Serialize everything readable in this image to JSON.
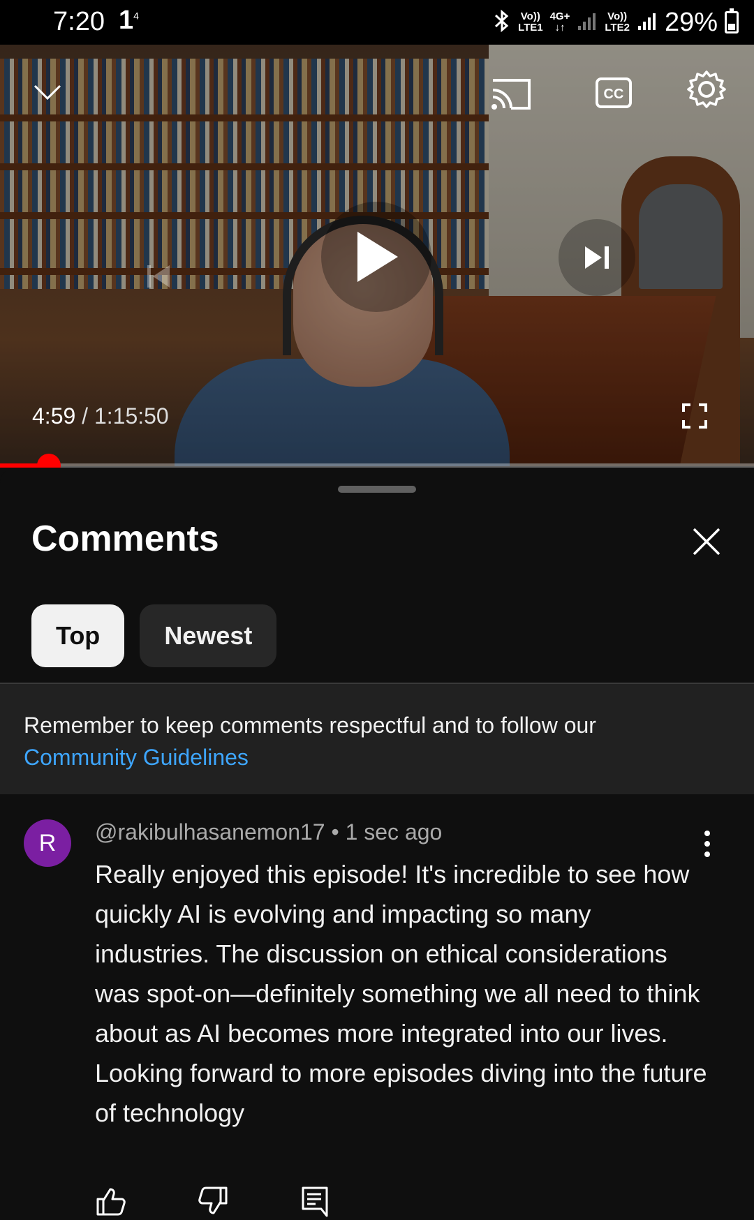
{
  "status_bar": {
    "time": "7:20",
    "notification": "1",
    "notification_sup": "4",
    "net1_top": "Vo))",
    "net1_bottom": "LTE1",
    "net_type_top": "4G+",
    "net_type_bottom": "↓↑",
    "net2_top": "Vo))",
    "net2_bottom": "LTE2",
    "battery": "29%"
  },
  "player": {
    "current_time": "4:59",
    "separator": " / ",
    "duration": "1:15:50",
    "progress_fraction": 0.065,
    "accent_color": "#ff0000"
  },
  "comments_panel": {
    "title": "Comments",
    "sort_chips": [
      {
        "label": "Top",
        "active": true
      },
      {
        "label": "Newest",
        "active": false
      }
    ],
    "notice_text": "Remember to keep comments respectful and to follow our",
    "notice_link": "Community Guidelines",
    "link_color": "#3ea6ff"
  },
  "comments": [
    {
      "avatar_letter": "R",
      "avatar_color": "#7b1fa2",
      "author": "@rakibulhasanemon17",
      "meta_separator": " • ",
      "time": "1 sec ago",
      "text": "Really enjoyed this episode! It's incredible to see how quickly AI is evolving and impacting so many industries. The discussion on ethical considerations was spot-on—definitely something we all need to think about as AI becomes more integrated into our lives. Looking forward to more episodes diving into the future of technology"
    }
  ],
  "icons": {
    "minimize": "chevron-down-icon",
    "cast": "cast-icon",
    "captions": "closed-captions-icon",
    "settings": "gear-icon",
    "previous": "previous-icon",
    "play": "play-icon",
    "next": "next-icon",
    "fullscreen": "fullscreen-icon",
    "close": "close-icon",
    "more": "more-vert-icon",
    "like": "thumbs-up-icon",
    "dislike": "thumbs-down-icon",
    "reply": "reply-icon"
  }
}
